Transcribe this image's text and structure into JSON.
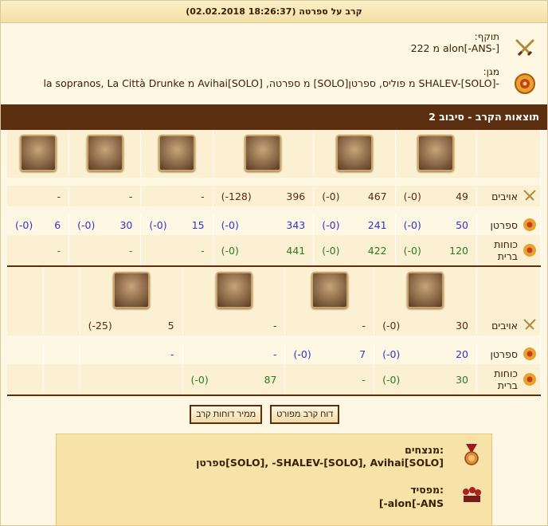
{
  "header": {
    "title": "קרב על ספרטה (18:26:37 02.02.2018)"
  },
  "attacker": {
    "label": "תוקף:",
    "value": "[-alon[-ANS מ 222"
  },
  "defender": {
    "label": "מגן:",
    "value": "-SHALEV-[SOLO] מ פוליס, ספרטן[SOLO] מ ספרטה, Avihai[SOLO] מ la sopranos, La Città Drunke"
  },
  "result_band": {
    "title": "תוצאות הקרב - סיבוב 2"
  },
  "row_labels": {
    "enemies": "אויבים",
    "sparta": "ספרטן",
    "allied": "כוחות ברית"
  },
  "section1": {
    "enemies": [
      [
        "49",
        "(0-)"
      ],
      [
        "467",
        "(0-)"
      ],
      [
        "396",
        "(128-)"
      ],
      [
        "-",
        ""
      ],
      [
        "-",
        ""
      ],
      [
        "-",
        ""
      ]
    ],
    "sparta": [
      [
        "50",
        "(0-)"
      ],
      [
        "241",
        "(0-)"
      ],
      [
        "343",
        "(0-)"
      ],
      [
        "15",
        "(0-)"
      ],
      [
        "30",
        "(0-)"
      ],
      [
        "6",
        "(0-)"
      ]
    ],
    "allied": [
      [
        "120",
        "(0-)"
      ],
      [
        "422",
        "(0-)"
      ],
      [
        "441",
        "(0-)"
      ],
      [
        "-",
        ""
      ],
      [
        "-",
        ""
      ],
      [
        "-",
        ""
      ]
    ]
  },
  "section2": {
    "enemies": [
      [
        "30",
        "(0-)"
      ],
      [
        "-",
        ""
      ],
      [
        "-",
        ""
      ],
      [
        "5",
        "(25-)"
      ],
      [
        "",
        ""
      ],
      [
        "",
        ""
      ]
    ],
    "sparta": [
      [
        "20",
        "(0-)"
      ],
      [
        "7",
        "(0-)"
      ],
      [
        "-",
        ""
      ],
      [
        "-",
        ""
      ],
      [
        "",
        ""
      ],
      [
        "",
        ""
      ]
    ],
    "allied": [
      [
        "30",
        "(0-)"
      ],
      [
        "-",
        ""
      ],
      [
        "87",
        "(0-)"
      ],
      [
        "",
        ""
      ],
      [
        "",
        ""
      ],
      [
        "",
        ""
      ]
    ]
  },
  "buttons": {
    "detailed_report": "דוח קרב מפורט",
    "convert_reports": "ממיר דוחות קרב"
  },
  "summary": {
    "winners_label": "מנצחים:",
    "winners_value": "ספרטן[SOLO], -SHALEV-[SOLO], Avihai[SOLO]",
    "loser_label": "מפסיד:",
    "loser_value": "[-alon[-ANS"
  },
  "colors": {
    "band": "#5a2e0e",
    "bg": "#fdf7e3",
    "own": "#3333cc",
    "ally": "#2a7a2a"
  },
  "icons": [
    "crossed-swords-icon",
    "shield-circle-icon",
    "medal-icon",
    "warriors-icon",
    "unit-portrait-icon"
  ]
}
